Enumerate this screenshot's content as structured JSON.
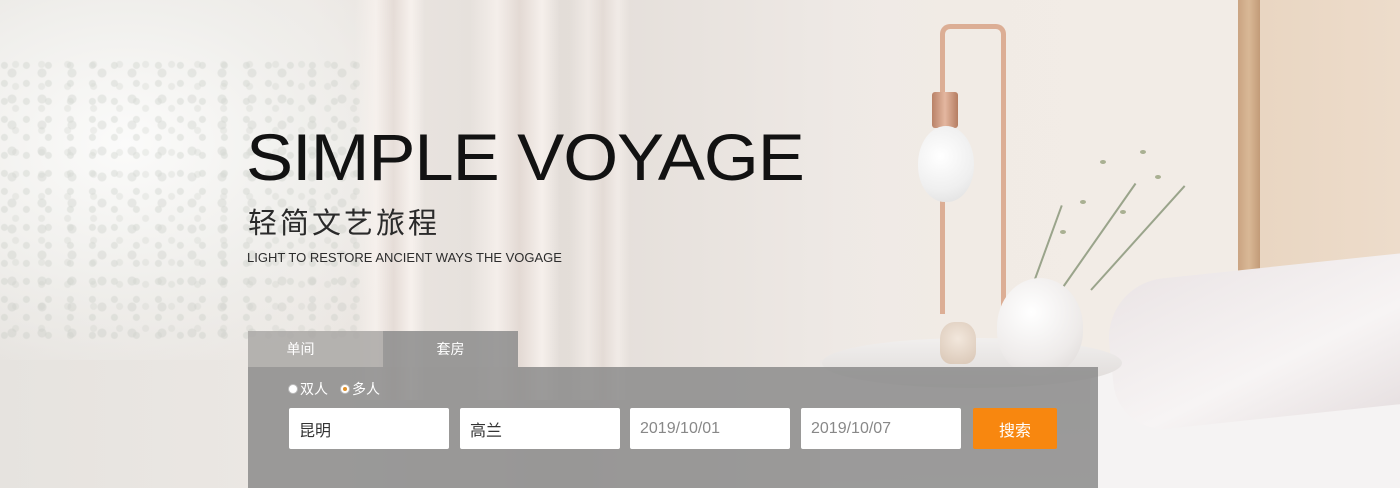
{
  "hero": {
    "title": "SIMPLE VOYAGE",
    "subtitle_cn": "轻简文艺旅程",
    "subtitle_en": "LIGHT TO RESTORE ANCIENT WAYS THE VOGAGE"
  },
  "search": {
    "tabs": [
      {
        "label": "单间",
        "active": false
      },
      {
        "label": "套房",
        "active": true
      }
    ],
    "radios": [
      {
        "label": "双人",
        "checked": false
      },
      {
        "label": "多人",
        "checked": true
      }
    ],
    "fields": {
      "origin": {
        "value": "昆明"
      },
      "destination": {
        "value": "高兰"
      },
      "checkin": {
        "placeholder": "2019/10/01"
      },
      "checkout": {
        "placeholder": "2019/10/07"
      }
    },
    "button_label": "搜索"
  },
  "colors": {
    "accent": "#f8870f",
    "panel": "#878787"
  }
}
